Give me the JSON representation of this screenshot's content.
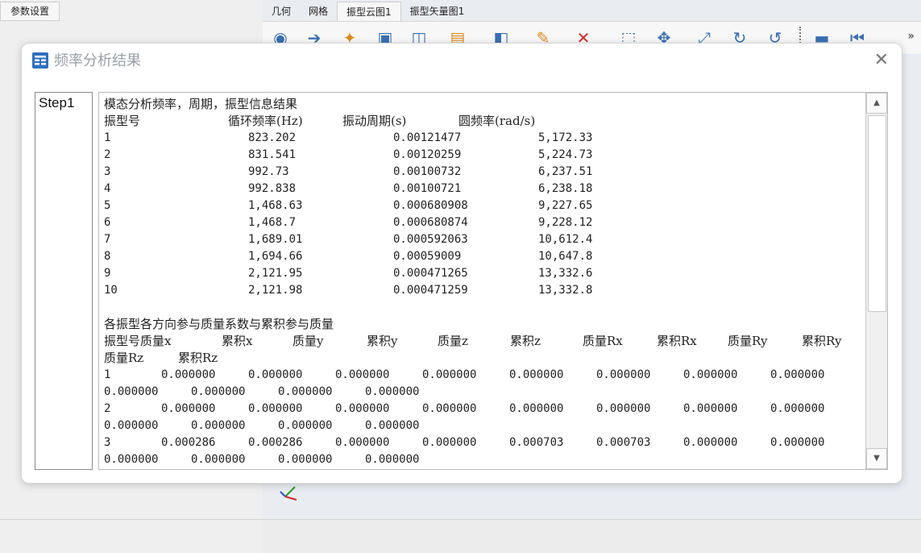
{
  "left_panel": {
    "tab_label": "参数设置"
  },
  "top_tabs": [
    "几何",
    "网格",
    "振型云图1",
    "振型矢量图1"
  ],
  "toolbar": {
    "icons": [
      "camera-icon",
      "export-icon",
      "bulb-icon",
      "fit-view-icon",
      "box-view-icon",
      "layers-icon",
      "lamp-icon",
      "brush-icon",
      "delete-icon",
      "zoom-box-icon",
      "pan-icon",
      "axis-icon",
      "rotate-icon",
      "reset-rotate-icon",
      "video-icon",
      "first-frame-icon"
    ],
    "more": "»"
  },
  "dialog": {
    "title": "频率分析结果",
    "close": "✕",
    "steps": [
      "Step1"
    ],
    "freq_section": {
      "title": "模态分析频率，周期，振型信息结果",
      "headers": [
        "振型号",
        "循环频率(Hz)",
        "振动周期(s)",
        "圆频率(rad/s)"
      ],
      "rows": [
        [
          "1",
          "823.202",
          "0.00121477",
          "5,172.33"
        ],
        [
          "2",
          "831.541",
          "0.00120259",
          "5,224.73"
        ],
        [
          "3",
          "992.73",
          "0.00100732",
          "6,237.51"
        ],
        [
          "4",
          "992.838",
          "0.00100721",
          "6,238.18"
        ],
        [
          "5",
          "1,468.63",
          "0.000680908",
          "9,227.65"
        ],
        [
          "6",
          "1,468.7",
          "0.000680874",
          "9,228.12"
        ],
        [
          "7",
          "1,689.01",
          "0.000592063",
          "10,612.4"
        ],
        [
          "8",
          "1,694.66",
          "0.00059009",
          "10,647.8"
        ],
        [
          "9",
          "2,121.95",
          "0.000471265",
          "13,332.6"
        ],
        [
          "10",
          "2,121.98",
          "0.000471259",
          "13,332.8"
        ]
      ]
    },
    "mass_section": {
      "title": "各振型各方向参与质量系数与累积参与质量",
      "headers_line1": [
        "振型号",
        "质量x",
        "累积x",
        "质量y",
        "累积y",
        "质量z",
        "累积z",
        "质量Rx",
        "累积Rx",
        "质量Ry",
        "累积Ry"
      ],
      "headers_line2": [
        "质量Rz",
        "累积Rz"
      ],
      "rows": [
        {
          "mode": "1",
          "line1": [
            "0.000000",
            "0.000000",
            "0.000000",
            "0.000000",
            "0.000000",
            "0.000000",
            "0.000000",
            "0.000000"
          ],
          "line2": [
            "0.000000",
            "0.000000",
            "0.000000",
            "0.000000"
          ]
        },
        {
          "mode": "2",
          "line1": [
            "0.000000",
            "0.000000",
            "0.000000",
            "0.000000",
            "0.000000",
            "0.000000",
            "0.000000",
            "0.000000"
          ],
          "line2": [
            "0.000000",
            "0.000000",
            "0.000000",
            "0.000000"
          ]
        },
        {
          "mode": "3",
          "line1": [
            "0.000286",
            "0.000286",
            "0.000000",
            "0.000000",
            "0.000703",
            "0.000703",
            "0.000000",
            "0.000000"
          ],
          "line2": [
            "0.000000",
            "0.000000",
            "0.000000",
            "0.000000"
          ]
        }
      ]
    }
  },
  "colors": {
    "accent": "#2f6fc0",
    "title_text": "#9aa0a6"
  }
}
